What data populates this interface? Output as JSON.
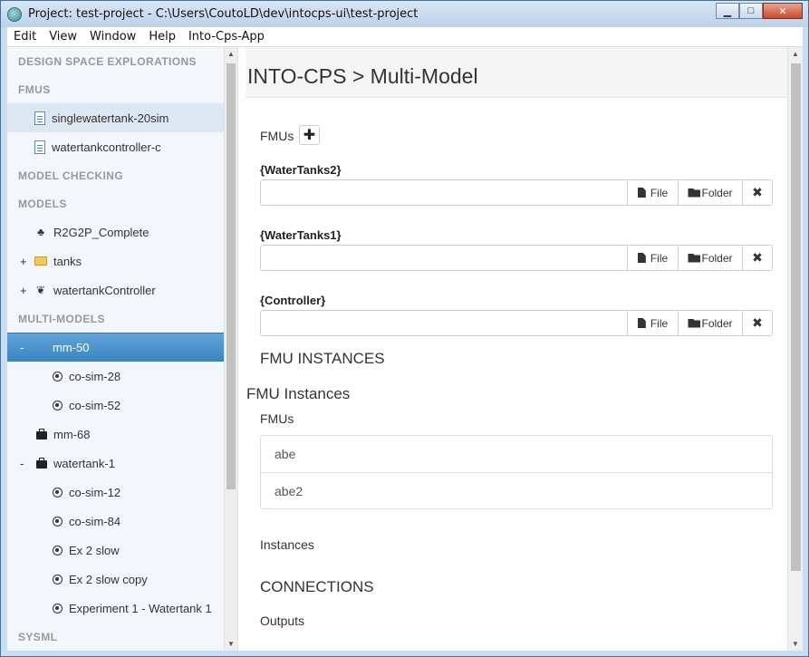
{
  "window": {
    "title": "Project: test-project - C:\\Users\\CoutoLD\\dev\\intocps-ui\\test-project",
    "minimize": "▁",
    "maximize": "□",
    "close": "✕"
  },
  "menu": [
    "Edit",
    "View",
    "Window",
    "Help",
    "Into-Cps-App"
  ],
  "sidebar": {
    "sections": {
      "dse": "DESIGN SPACE EXPLORATIONS",
      "fmus": "FMUS",
      "model_checking": "MODEL CHECKING",
      "models": "MODELS",
      "multi_models": "MULTI-MODELS",
      "sysml": "SYSML"
    },
    "fmus": [
      "singlewatertank-20sim",
      "watertankcontroller-c"
    ],
    "models": [
      {
        "toggle": "",
        "icon": "tree-icon",
        "label": "R2G2P_Complete"
      },
      {
        "toggle": "+",
        "icon": "folder-icon",
        "label": "tanks"
      },
      {
        "toggle": "+",
        "icon": "leaf-icon",
        "label": "watertankController"
      }
    ],
    "multi_models": {
      "mm50": {
        "toggle": "-",
        "label": "mm-50",
        "children": [
          "co-sim-28",
          "co-sim-52"
        ]
      },
      "mm68": {
        "label": "mm-68"
      },
      "watertank1": {
        "toggle": "-",
        "label": "watertank-1",
        "children": [
          "co-sim-12",
          "co-sim-84",
          "Ex 2 slow",
          "Ex 2 slow copy",
          "Experiment 1 - Watertank 1"
        ]
      }
    }
  },
  "main": {
    "title": "INTO-CPS > Multi-Model",
    "fmus_label": "FMUs",
    "add_symbol": "✚",
    "fmu_entries": [
      {
        "name": "{WaterTanks2}",
        "value": ""
      },
      {
        "name": "{WaterTanks1}",
        "value": ""
      },
      {
        "name": "{Controller}",
        "value": ""
      }
    ],
    "file_label": "File",
    "folder_label": "Folder",
    "remove_symbol": "✖",
    "fmu_instances_heading": "FMU INSTANCES",
    "fmu_instances_title": "FMU Instances",
    "fmus_sublabel": "FMUs",
    "fmu_list": [
      "abe",
      "abe2"
    ],
    "instances_label": "Instances",
    "connections_heading": "CONNECTIONS",
    "outputs_label": "Outputs"
  }
}
